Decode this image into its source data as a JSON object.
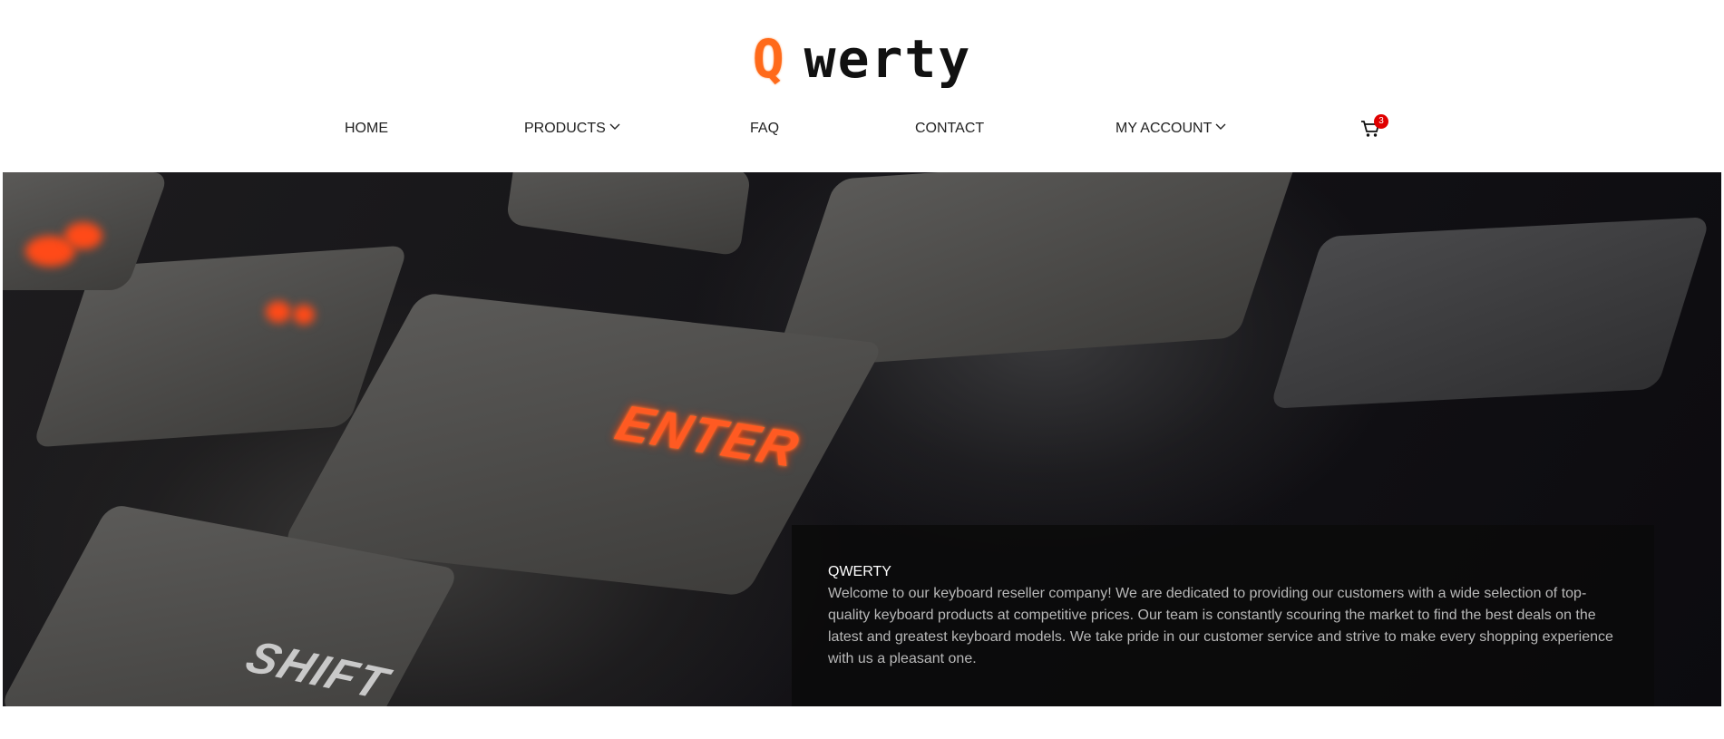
{
  "brand": {
    "logo_first": "Q",
    "logo_rest": "werty",
    "accent_color": "#ff6a1a"
  },
  "nav": {
    "items": [
      {
        "label": "HOME",
        "has_dropdown": false
      },
      {
        "label": "PRODUCTS",
        "has_dropdown": true
      },
      {
        "label": "FAQ",
        "has_dropdown": false
      },
      {
        "label": "CONTACT",
        "has_dropdown": false
      },
      {
        "label": "MY ACCOUNT",
        "has_dropdown": true
      }
    ],
    "cart": {
      "icon": "cart-icon",
      "count": "3",
      "badge_color": "#e00000"
    }
  },
  "hero": {
    "title": "QWERTY",
    "description": "Welcome to our keyboard reseller company! We are dedicated to providing our customers with a wide selection of top-quality keyboard products at competitive prices. Our team is constantly scouring the market to find the best deals on the latest and greatest keyboard models. We take pride in our customer service and strive to make every shopping experience with us a pleasant one.",
    "image": {
      "key_labels": [
        "ENTER",
        "SHIFT"
      ]
    }
  }
}
